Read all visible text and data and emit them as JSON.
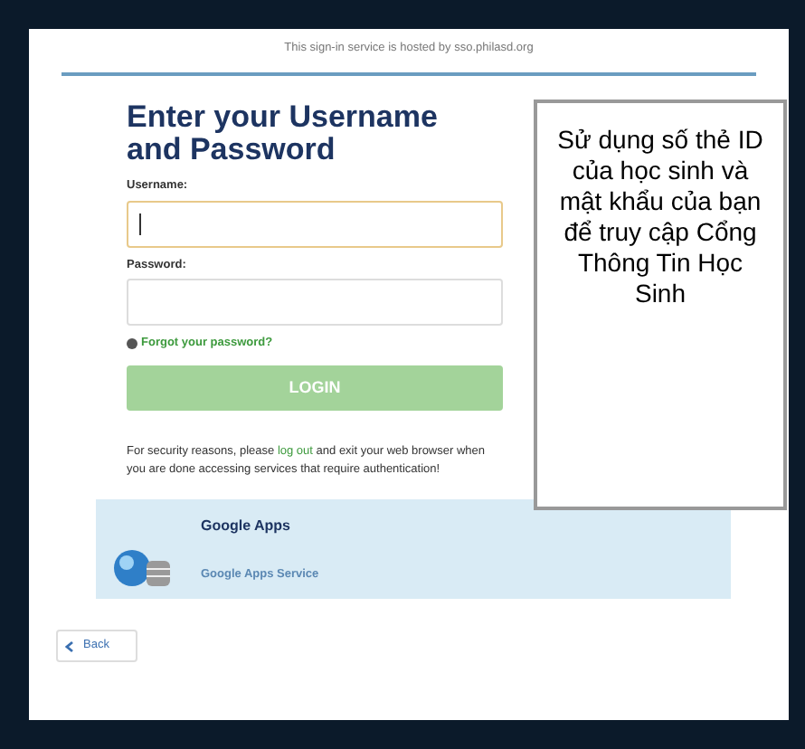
{
  "header": {
    "text": "This sign-in service is hosted by sso.philasd.org"
  },
  "login": {
    "title": "Enter your Username and Password",
    "username": {
      "label": "Username:",
      "focused": true
    },
    "password": {
      "label": "Password:"
    },
    "forgot": "Forgot your password?",
    "button": {
      "label": "LOGIN",
      "disabled": true
    },
    "notice": {
      "before": "For security reasons, please ",
      "link": "log out",
      "after": " and exit your web browser when you are done accessing services that require authentication!"
    }
  },
  "callout": {
    "text": "Sử dụng số thẻ ID của học sinh và mật khẩu của bạn để truy cập Cổng Thông Tin Học Sinh"
  },
  "service": {
    "name": "Google Apps",
    "description": "Google Apps Service"
  },
  "back": {
    "label": "Back"
  }
}
